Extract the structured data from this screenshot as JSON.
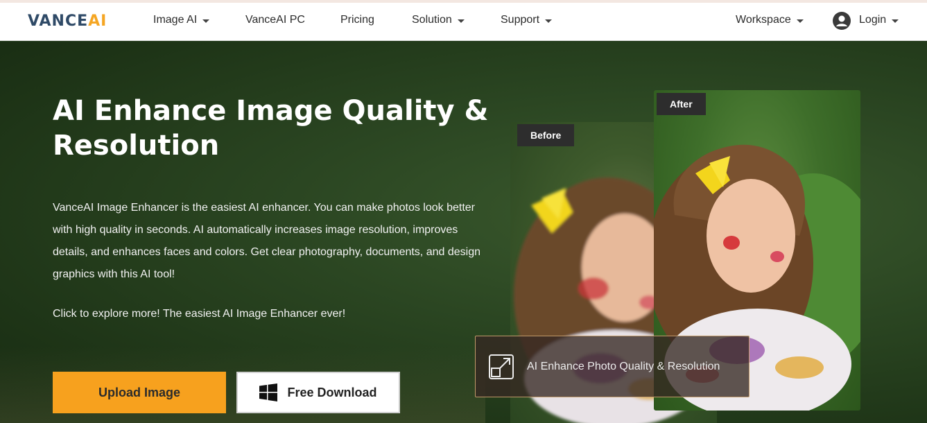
{
  "brand": {
    "logo_main": "VANCE",
    "logo_accent": "AI",
    "accent_color": "#f5a623"
  },
  "nav": {
    "items": [
      {
        "label": "Image AI",
        "has_dropdown": true
      },
      {
        "label": "VanceAI PC",
        "has_dropdown": false
      },
      {
        "label": "Pricing",
        "has_dropdown": false
      },
      {
        "label": "Solution",
        "has_dropdown": true
      },
      {
        "label": "Support",
        "has_dropdown": true
      }
    ],
    "workspace": "Workspace",
    "login": "Login"
  },
  "hero": {
    "title": "AI Enhance Image Quality & Resolution",
    "description": "VanceAI Image Enhancer is the easiest AI enhancer. You can make photos look better with high quality in seconds. AI automatically increases image resolution, improves details, and enhances faces and colors. Get clear photography, documents, and design graphics with this AI tool!",
    "explore": "Click to explore more! The easiest AI Image Enhancer ever!",
    "upload_button": "Upload Image",
    "download_button": "Free Download",
    "upload_color": "#f7a11e"
  },
  "compare": {
    "before_tag": "Before",
    "after_tag": "After",
    "caption": "AI Enhance Photo Quality & Resolution"
  }
}
